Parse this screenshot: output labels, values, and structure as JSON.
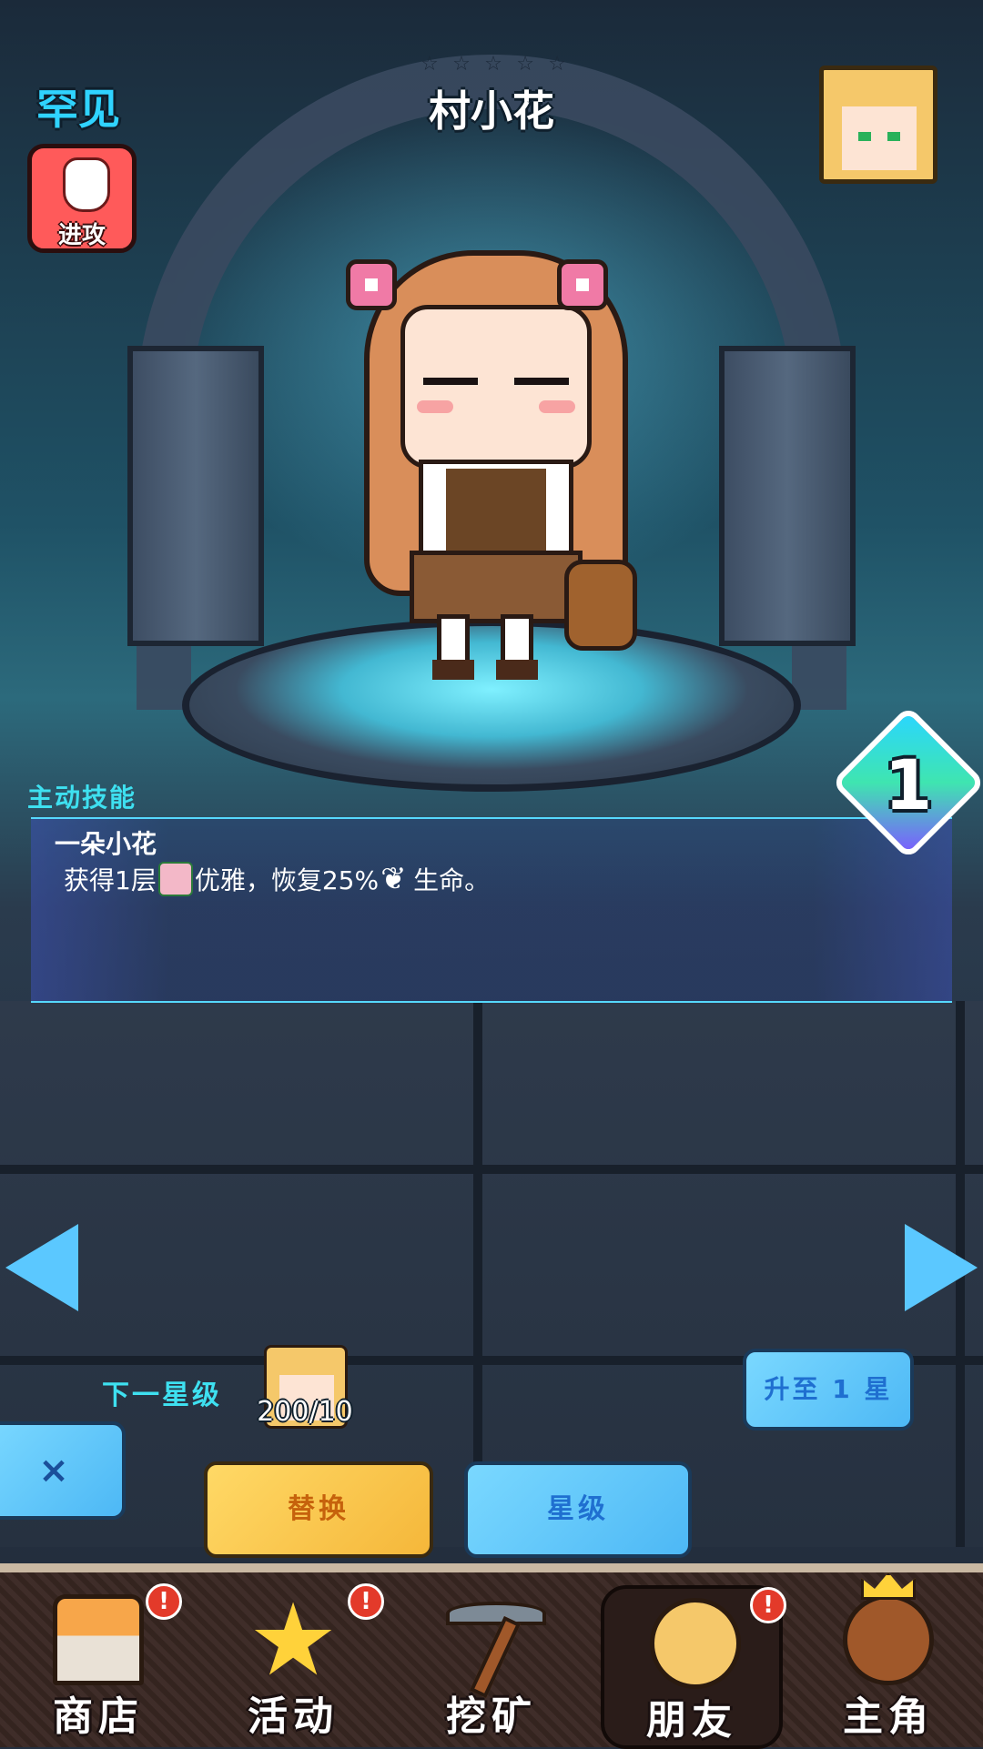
{
  "header": {
    "rarity": "罕见",
    "attack_label": "进攻",
    "stars": [
      "☆",
      "☆",
      "☆",
      "☆",
      "☆"
    ],
    "character_name": "村小花"
  },
  "skill": {
    "section_title": "主动技能",
    "name": "一朵小花",
    "desc_part1": "获得1层",
    "desc_part2": "优雅，恢复25%",
    "desc_part3": "生命。",
    "level": "1"
  },
  "upgrade": {
    "next_star_label": "下一星级",
    "shard_count": "200/10",
    "upgrade_button": "升至 1 星"
  },
  "actions": {
    "close_label": "×",
    "replace_label": "替换",
    "star_label": "星级"
  },
  "nav": {
    "items": [
      {
        "label": "商店",
        "icon": "shop-icon",
        "badge": "!"
      },
      {
        "label": "活动",
        "icon": "star-icon",
        "badge": "!"
      },
      {
        "label": "挖矿",
        "icon": "pickaxe-icon",
        "badge": ""
      },
      {
        "label": "朋友",
        "icon": "friend-icon",
        "badge": "!"
      },
      {
        "label": "主角",
        "icon": "hero-icon",
        "badge": ""
      }
    ],
    "active_index": 3
  },
  "colors": {
    "accent_cyan": "#3ee0f0",
    "button_blue": "#4db8f5",
    "button_yellow": "#f5b73a",
    "attack_red": "#ff5a5a"
  }
}
